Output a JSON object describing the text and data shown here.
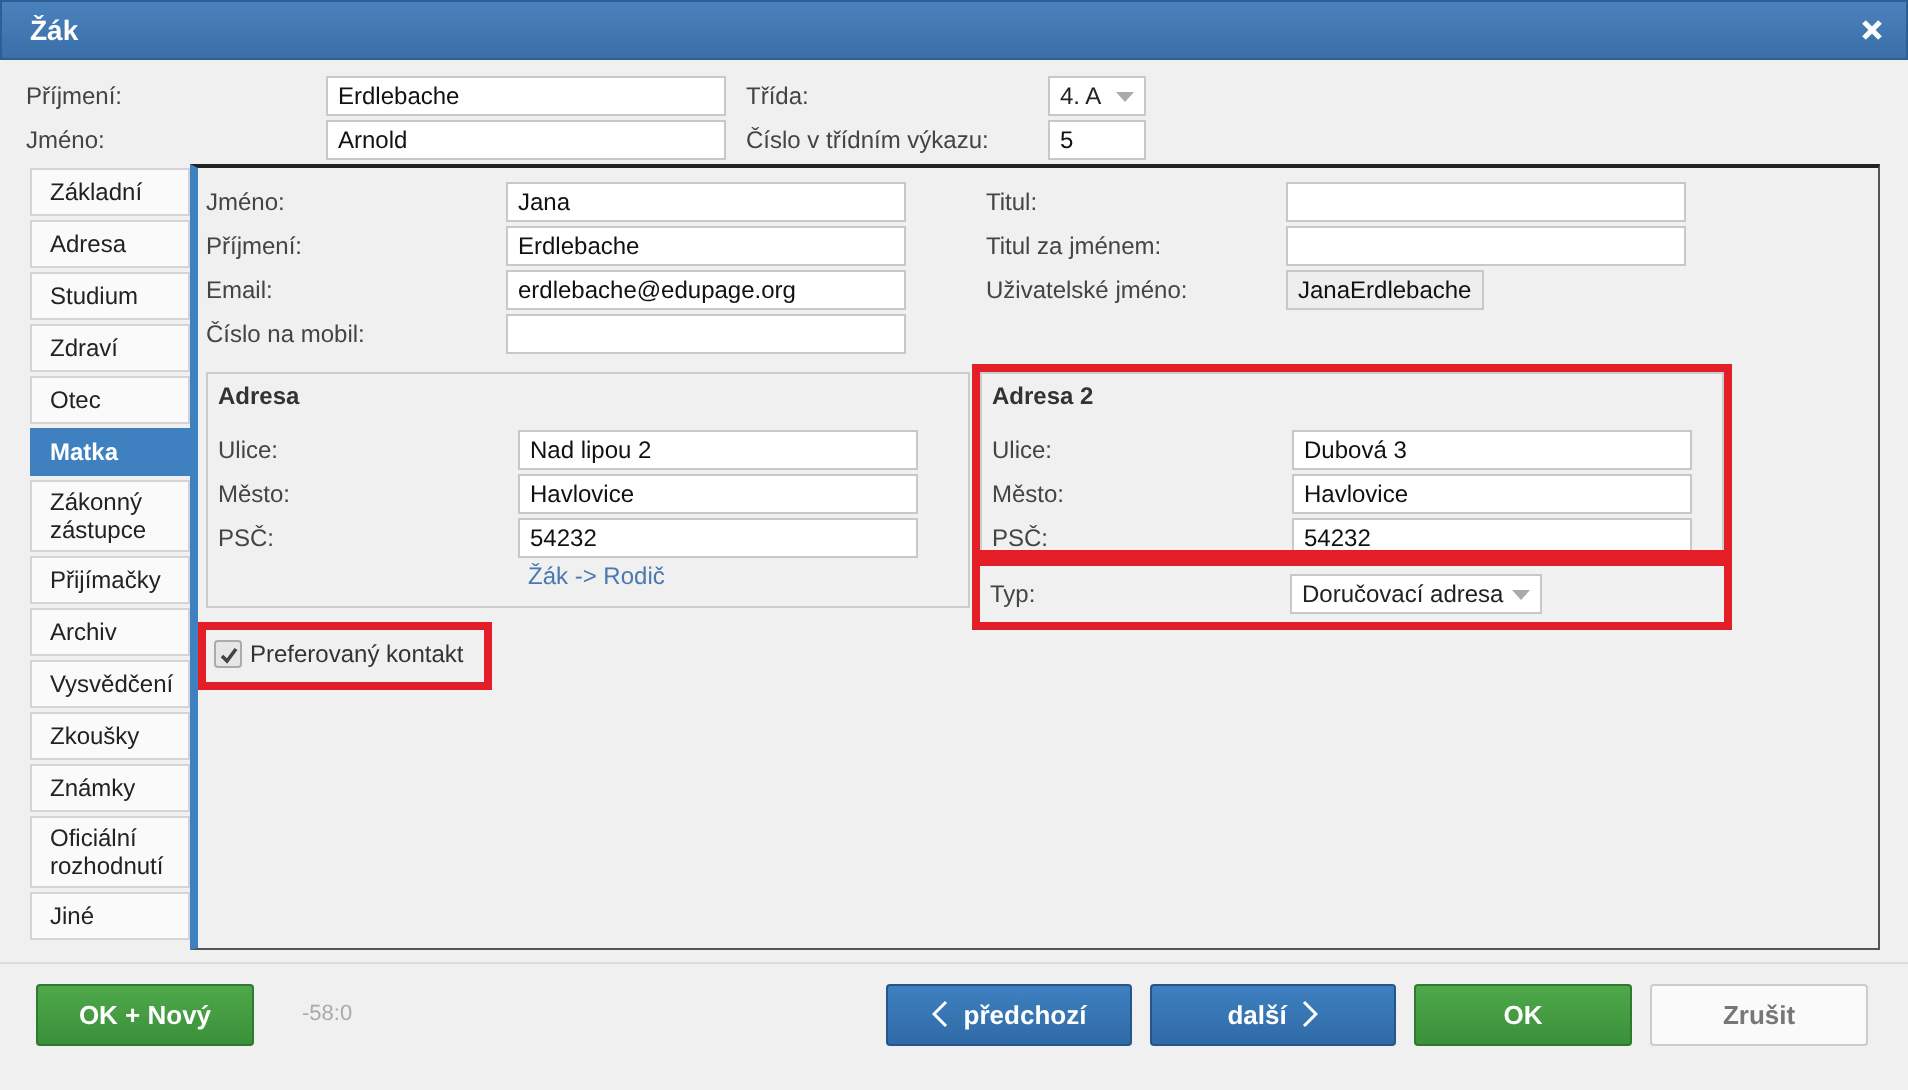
{
  "window": {
    "title": "Žák"
  },
  "header": {
    "left": [
      {
        "label": "Příjmení:",
        "value": "Erdlebache"
      },
      {
        "label": "Jméno:",
        "value": "Arnold"
      }
    ],
    "right": [
      {
        "label": "Třída:",
        "value": "4. A",
        "kind": "select"
      },
      {
        "label": "Číslo v třídním výkazu:",
        "value": "5",
        "kind": "text"
      }
    ]
  },
  "tabs": [
    {
      "label": "Základní",
      "selected": false
    },
    {
      "label": "Adresa",
      "selected": false
    },
    {
      "label": "Studium",
      "selected": false
    },
    {
      "label": "Zdraví",
      "selected": false
    },
    {
      "label": "Otec",
      "selected": false
    },
    {
      "label": "Matka",
      "selected": true
    },
    {
      "label": "Zákonný zástupce",
      "selected": false
    },
    {
      "label": "Přijímačky",
      "selected": false
    },
    {
      "label": "Archiv",
      "selected": false
    },
    {
      "label": "Vysvědčení",
      "selected": false
    },
    {
      "label": "Zkoušky",
      "selected": false
    },
    {
      "label": "Známky",
      "selected": false
    },
    {
      "label": "Oficiální rozhodnutí",
      "selected": false
    },
    {
      "label": "Jiné",
      "selected": false
    }
  ],
  "person": {
    "left": [
      {
        "label": "Jméno:",
        "value": "Jana"
      },
      {
        "label": "Příjmení:",
        "value": "Erdlebache"
      },
      {
        "label": "Email:",
        "value": "erdlebache@edupage.org"
      },
      {
        "label": "Číslo na mobil:"
      }
    ],
    "right": [
      {
        "label": "Titul:",
        "kind": "text"
      },
      {
        "label": "Titul za jménem:",
        "kind": "text"
      },
      {
        "label": "Uživatelské jméno:",
        "value": "JanaErdlebache",
        "kind": "readonly"
      }
    ]
  },
  "address": {
    "title": "Adresa",
    "highlighted": false,
    "fields": [
      {
        "label": "Ulice:",
        "value": "Nad lipou 2"
      },
      {
        "label": "Město:",
        "value": "Havlovice"
      },
      {
        "label": "PSČ:",
        "value": "54232"
      }
    ],
    "link": "Žák -> Rodič"
  },
  "address2": {
    "title": "Adresa 2",
    "highlighted": true,
    "fields": [
      {
        "label": "Ulice:",
        "value": "Dubová 3"
      },
      {
        "label": "Město:",
        "value": "Havlovice"
      },
      {
        "label": "PSČ:",
        "value": "54232"
      }
    ],
    "type": {
      "label": "Typ:",
      "value": "Doručovací adresa",
      "highlighted": true
    }
  },
  "preferred": {
    "label": "Preferovaný kontakt",
    "checked": true,
    "highlighted": true
  },
  "footer": {
    "left": [
      {
        "label": "OK + Nový",
        "kind": "green"
      }
    ],
    "code": "-58:0",
    "right": [
      {
        "label": "předchozí",
        "kind": "prev"
      },
      {
        "label": "další",
        "kind": "next"
      },
      {
        "label": "OK",
        "kind": "green"
      },
      {
        "label": "Zrušit",
        "kind": "plain"
      }
    ]
  }
}
